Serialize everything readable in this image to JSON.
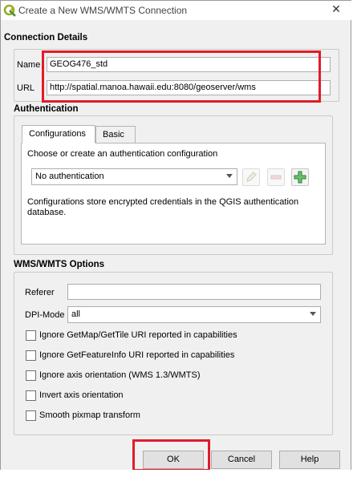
{
  "window": {
    "title": "Create a New WMS/WMTS Connection",
    "close_glyph": "✕",
    "icon": "qgis-logo-icon"
  },
  "connection": {
    "heading": "Connection Details",
    "name_label": "Name",
    "name_value": "GEOG476_std",
    "url_label": "URL",
    "url_value": "http://spatial.manoa.hawaii.edu:8080/geoserver/wms"
  },
  "authentication": {
    "heading": "Authentication",
    "tabs": [
      {
        "label": "Configurations",
        "active": true
      },
      {
        "label": "Basic",
        "active": false
      }
    ],
    "prompt": "Choose or create an authentication configuration",
    "selected": "No authentication",
    "info": "Configurations store encrypted credentials in the QGIS authentication database.",
    "icons": [
      "edit-pencil-icon",
      "remove-minus-icon",
      "add-plus-icon"
    ]
  },
  "options": {
    "heading": "WMS/WMTS Options",
    "referer_label": "Referer",
    "referer_value": "",
    "dpi_label": "DPI-Mode",
    "dpi_value": "all",
    "checkboxes": [
      {
        "label": "Ignore GetMap/GetTile URI reported in capabilities",
        "checked": false
      },
      {
        "label": "Ignore GetFeatureInfo URI reported in capabilities",
        "checked": false
      },
      {
        "label": "Ignore axis orientation (WMS 1.3/WMTS)",
        "checked": false
      },
      {
        "label": "Invert axis orientation",
        "checked": false
      },
      {
        "label": "Smooth pixmap transform",
        "checked": false
      }
    ]
  },
  "buttons": {
    "ok": "OK",
    "cancel": "Cancel",
    "help": "Help"
  },
  "colors": {
    "highlight": "#e01c2a",
    "plus_green": "#2e9e3a"
  }
}
